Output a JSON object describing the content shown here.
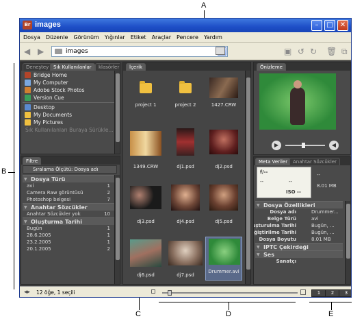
{
  "callouts": {
    "a": "A",
    "b": "B",
    "c": "C",
    "d": "D",
    "e": "E"
  },
  "window": {
    "app_icon": "Br",
    "title": "images"
  },
  "menu": [
    "Dosya",
    "Düzenle",
    "Görünüm",
    "Yığınlar",
    "Etiket",
    "Araçlar",
    "Pencere",
    "Yardım"
  ],
  "toolbar": {
    "path": "images"
  },
  "left_top": {
    "tabs": [
      "Deneştey",
      "Sık Kullanılanlar",
      "klasörler"
    ],
    "items": [
      "Bridge Home",
      "My Computer",
      "Adobe Stock Photos",
      "Version Cue",
      "Desktop",
      "My Documents",
      "My Pictures"
    ],
    "hint": "Sık Kullanılanları Buraya Sürükle..."
  },
  "filter": {
    "tab": "Filtre",
    "sort": "Sıralama Ölçütü: Dosya adı",
    "sections": [
      {
        "title": "Dosya Türü",
        "rows": [
          [
            "avi",
            "1"
          ],
          [
            "Camera Raw görüntüsü",
            "2"
          ],
          [
            "Photoshop belgesi",
            "7"
          ]
        ]
      },
      {
        "title": "Anahtar Sözcükler",
        "rows": [
          [
            "Anahtar Sözcükler yok",
            "10"
          ]
        ]
      },
      {
        "title": "Oluşturma Tarihi",
        "rows": [
          [
            "Bugün",
            "1"
          ],
          [
            "28.6.2005",
            "1"
          ],
          [
            "23.2.2005",
            "1"
          ],
          [
            "20.1.2005",
            "2"
          ]
        ]
      }
    ]
  },
  "content": {
    "tab": "İçerik",
    "items": [
      "project 1",
      "project 2",
      "1427.CRW",
      "1349.CRW",
      "dj1.psd",
      "dj2.psd",
      "dj3.psd",
      "dj4.psd",
      "dj5.psd",
      "dj6.psd",
      "dj7.psd",
      "Drummer.avi"
    ]
  },
  "preview": {
    "tab": "Önizleme"
  },
  "metadata": {
    "tabs": [
      "Meta Veriler",
      "Anahtar Sözcükler"
    ],
    "fstop": "f/--",
    "dashes": "--",
    "iso": "ISO --",
    "size": "8.01 MB",
    "section_file": "Dosya Özellikleri",
    "rows": [
      [
        "Dosya adı",
        "Drummer..."
      ],
      [
        "Belge Türü",
        "avi"
      ],
      [
        "Oluşturulma Tarihi",
        "Bugün, ..."
      ],
      [
        "Değiştirilme Tarihi",
        "Bugün, ..."
      ],
      [
        "Dosya Boyutu",
        "8.01 MB"
      ]
    ],
    "section_iptc": "IPTC Çekirdeği",
    "section_audio": "Ses",
    "audio_row": "Sanatçı"
  },
  "status": {
    "text": "12 öğe, 1 seçili",
    "views": [
      "1",
      "2",
      "3"
    ]
  }
}
